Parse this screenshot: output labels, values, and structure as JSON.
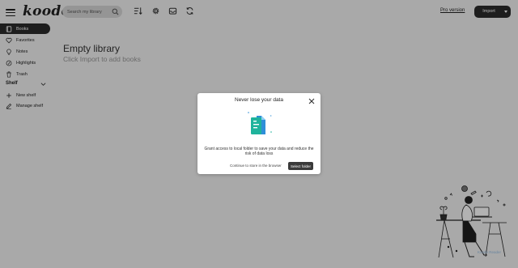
{
  "app": {
    "logo": "koodo"
  },
  "search": {
    "placeholder": "Search my library"
  },
  "header": {
    "pro_version": "Pro version",
    "import_label": "Import"
  },
  "sidebar": {
    "items": [
      {
        "label": "Books",
        "icon": "book-icon",
        "active": true
      },
      {
        "label": "Favorites",
        "icon": "heart-icon",
        "active": false
      },
      {
        "label": "Notes",
        "icon": "lightbulb-icon",
        "active": false
      },
      {
        "label": "Highlights",
        "icon": "highlight-icon",
        "active": false
      },
      {
        "label": "Trash",
        "icon": "trash-icon",
        "active": false
      }
    ],
    "shelf_heading": "Shelf",
    "shelf_items": [
      {
        "label": "New shelf",
        "icon": "plus-icon"
      },
      {
        "label": "Manage shelf",
        "icon": "pencil-icon"
      }
    ]
  },
  "main": {
    "title": "Empty library",
    "subtitle": "Click Import to add books"
  },
  "modal": {
    "title": "Never lose your data",
    "description": "Grant access to local folder to save your data and reduce the risk of data loss",
    "continue_label": "Continue to store in the browser",
    "select_label": "Select folder"
  },
  "colors": {
    "accent_dark": "#2c2c2c",
    "illustration_teal": "#1fb39c",
    "illustration_blue": "#2f8fd8"
  }
}
